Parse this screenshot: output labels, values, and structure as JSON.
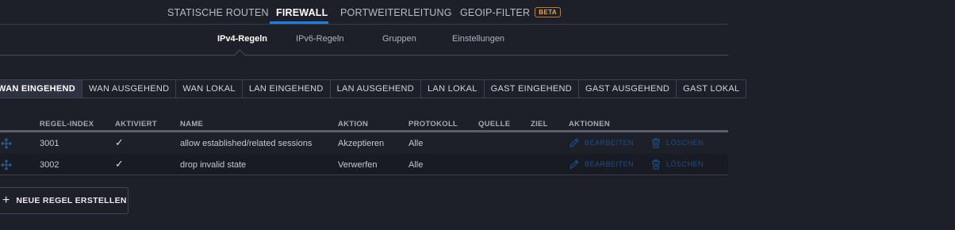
{
  "top_tabs": {
    "static_routes": "STATISCHE ROUTEN",
    "firewall": "FIREWALL",
    "port_forwarding": "PORTWEITERLEITUNG",
    "geoip_filter": "GEOIP-FILTER",
    "beta_badge": "BETA"
  },
  "sub_tabs": {
    "ipv4": "IPv4-Regeln",
    "ipv6": "IPv6-Regeln",
    "groups": "Gruppen",
    "settings": "Einstellungen"
  },
  "ruleset_tabs": [
    "WAN EINGEHEND",
    "WAN AUSGEHEND",
    "WAN LOKAL",
    "LAN EINGEHEND",
    "LAN AUSGEHEND",
    "LAN LOKAL",
    "GAST EINGEHEND",
    "GAST AUSGEHEND",
    "GAST LOKAL"
  ],
  "active_ruleset": "WAN EINGEHEND",
  "table": {
    "columns": {
      "index": "REGEL-INDEX",
      "enabled": "AKTIVIERT",
      "name": "NAME",
      "action": "AKTION",
      "protocol": "PROTOKOLL",
      "source": "QUELLE",
      "destination": "ZIEL",
      "actions": "AKTIONEN"
    },
    "rows": [
      {
        "index": "3001",
        "enabled": "✓",
        "name": "allow established/related sessions",
        "action": "Akzeptieren",
        "protocol": "Alle",
        "source": "",
        "destination": ""
      },
      {
        "index": "3002",
        "enabled": "✓",
        "name": "drop invalid state",
        "action": "Verwerfen",
        "protocol": "Alle",
        "source": "",
        "destination": ""
      }
    ],
    "edit_label": "BEARBEITEN",
    "delete_label": "LÖSCHEN"
  },
  "new_rule_button": "NEUE REGEL ERSTELLEN",
  "colors": {
    "background": "#1d1f29",
    "accent": "#1a7fe6",
    "beta": "#f1a74a",
    "disabled_action": "#1e4e85"
  },
  "icons": {
    "drag": "drag-handle-icon",
    "edit": "pencil-icon",
    "delete": "trash-icon",
    "add": "plus-icon",
    "check": "checkmark-icon"
  }
}
